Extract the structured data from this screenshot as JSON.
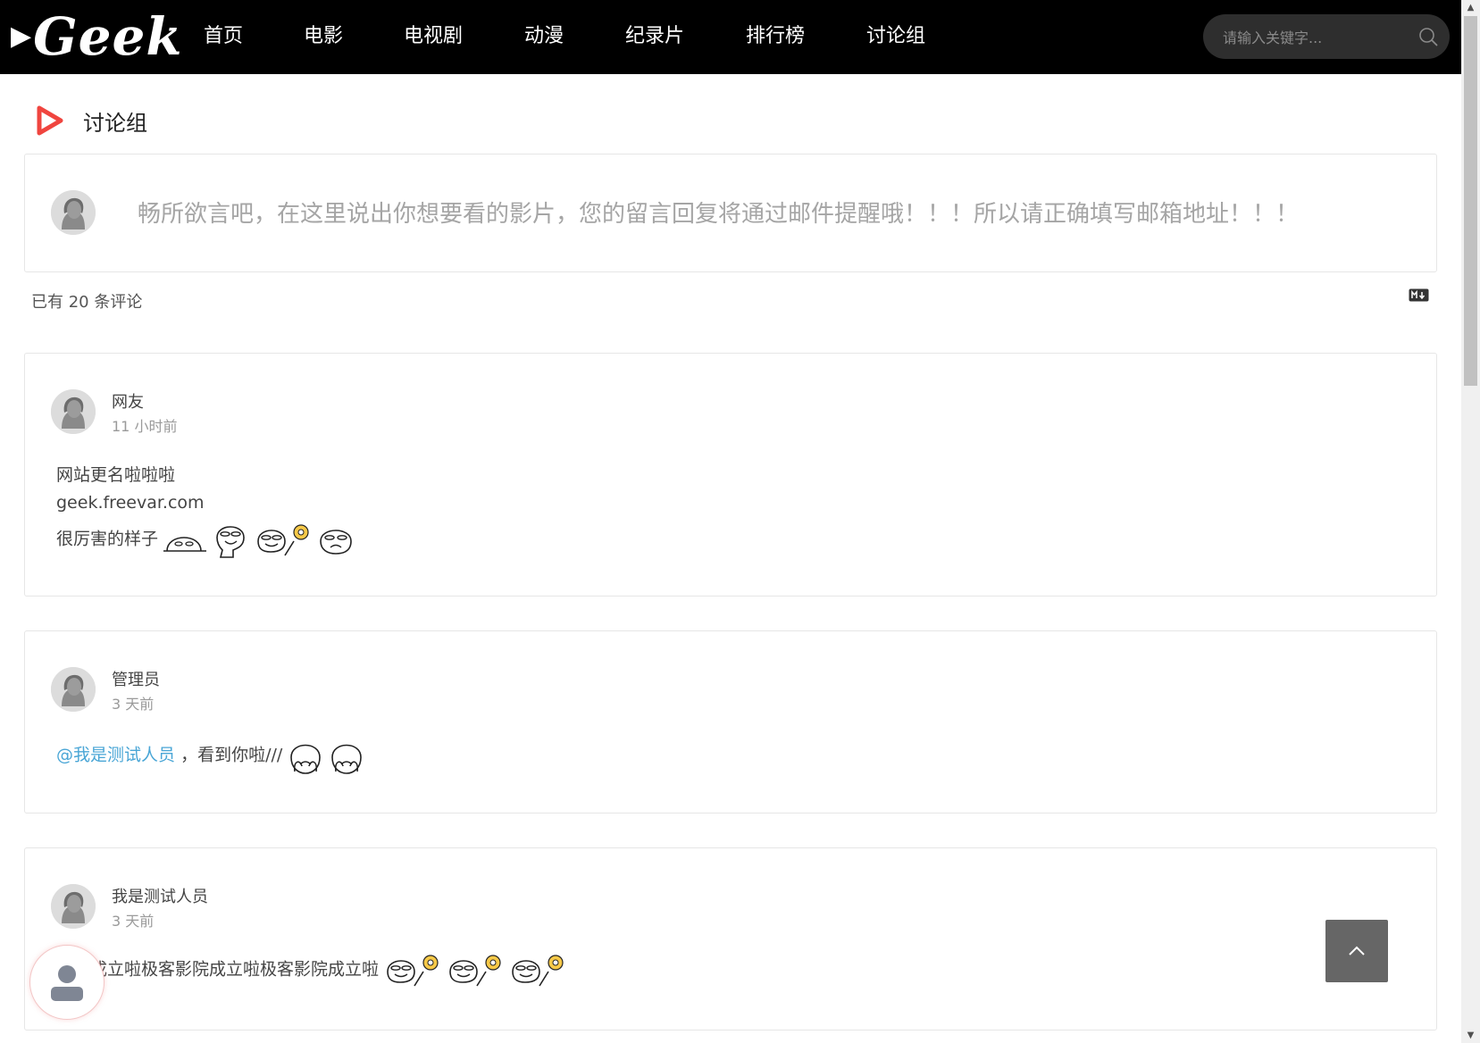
{
  "header": {
    "logo_text": "Geek",
    "nav": [
      {
        "label": "首页"
      },
      {
        "label": "电影"
      },
      {
        "label": "电视剧"
      },
      {
        "label": "动漫"
      },
      {
        "label": "纪录片"
      },
      {
        "label": "排行榜"
      },
      {
        "label": "讨论组"
      }
    ],
    "search_placeholder": "请输入关键字..."
  },
  "section": {
    "title": "讨论组",
    "accent_color": "#f0453f"
  },
  "comment_box": {
    "placeholder": "畅所欲言吧，在这里说出你想要看的影片，您的留言回复将通过邮件提醒哦！！！所以请正确填写邮箱地址！！！"
  },
  "comments_header": {
    "count_text": "已有 20 条评论",
    "markdown_icon": "markdown-icon"
  },
  "comments": [
    {
      "author": "网友",
      "time": "11 小时前",
      "lines": [
        "网站更名啦啦啦",
        "geek.freevar.com",
        "很厉害的样子"
      ]
    },
    {
      "author": "管理员",
      "time": "3 天前",
      "mention": "@我是测试人员",
      "text": "，看到你啦///"
    },
    {
      "author": "我是测试人员",
      "time": "3 天前",
      "text": "影院成立啦极客影院成立啦极客影院成立啦"
    }
  ],
  "colors": {
    "mention": "#4aa6d6",
    "nav_bg": "#000000"
  }
}
